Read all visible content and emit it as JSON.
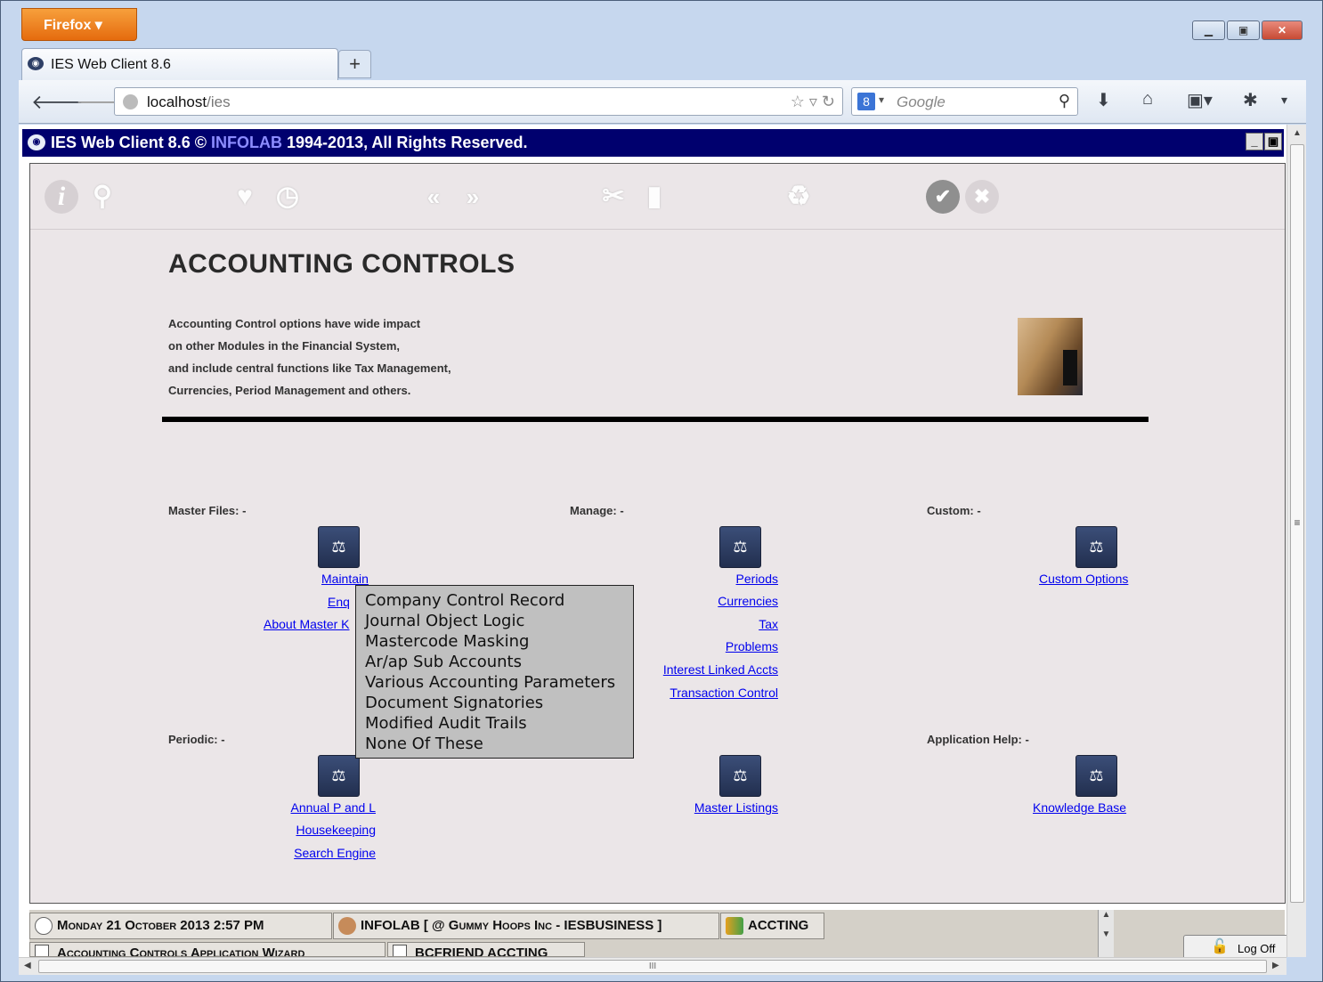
{
  "browser": {
    "menu_button": "Firefox",
    "tab_title": "IES Web Client 8.6",
    "new_tab": "+",
    "url_host": "localhost",
    "url_path": "/ies",
    "search_placeholder": "Google",
    "search_engine": "8"
  },
  "app": {
    "title_prefix": "IES Web Client 8.6 ©",
    "title_company": "INFOLAB",
    "title_suffix": "1994-2013, All Rights Reserved.",
    "heading": "ACCOUNTING CONTROLS",
    "description": [
      "Accounting Control options have wide impact",
      "on other Modules in the Financial System,",
      "and include central functions like Tax Management,",
      "Currencies, Period Management and others."
    ]
  },
  "sections": {
    "master_files": {
      "label": "Master Files: -",
      "links": [
        "Maintain",
        "Enq",
        "About Master K"
      ]
    },
    "manage": {
      "label": "Manage: -",
      "links": [
        "Periods",
        "Currencies",
        "Tax",
        "Problems",
        "Interest Linked Accts",
        "Transaction Control"
      ]
    },
    "custom": {
      "label": "Custom: -",
      "links": [
        "Custom Options"
      ]
    },
    "periodic": {
      "label": "Periodic: -",
      "links": [
        "Annual P and L",
        "Housekeeping",
        "Search Engine"
      ]
    },
    "reports": {
      "links": [
        "Master Listings"
      ]
    },
    "application_help": {
      "label": "Application Help: -",
      "links": [
        "Knowledge Base"
      ]
    }
  },
  "popup_menu": {
    "items": [
      "Company Control Record",
      "Journal Object Logic",
      "Mastercode Masking",
      "Ar/ap Sub Accounts",
      "Various Accounting Parameters",
      "Document Signatories",
      "Modified Audit Trails",
      "None Of These"
    ]
  },
  "statusbar": {
    "datetime": "Monday 21 October 2013 2:57 PM",
    "user": "INFOLAB [ @ Gummy Hoops Inc - IESBUSINESS ]",
    "module": "ACCTING",
    "wizard": "Accounting Controls Application Wizard",
    "frontend": "BCFRIEND ACCTING",
    "logoff": "Log Off"
  },
  "hscroll_grip": "III"
}
